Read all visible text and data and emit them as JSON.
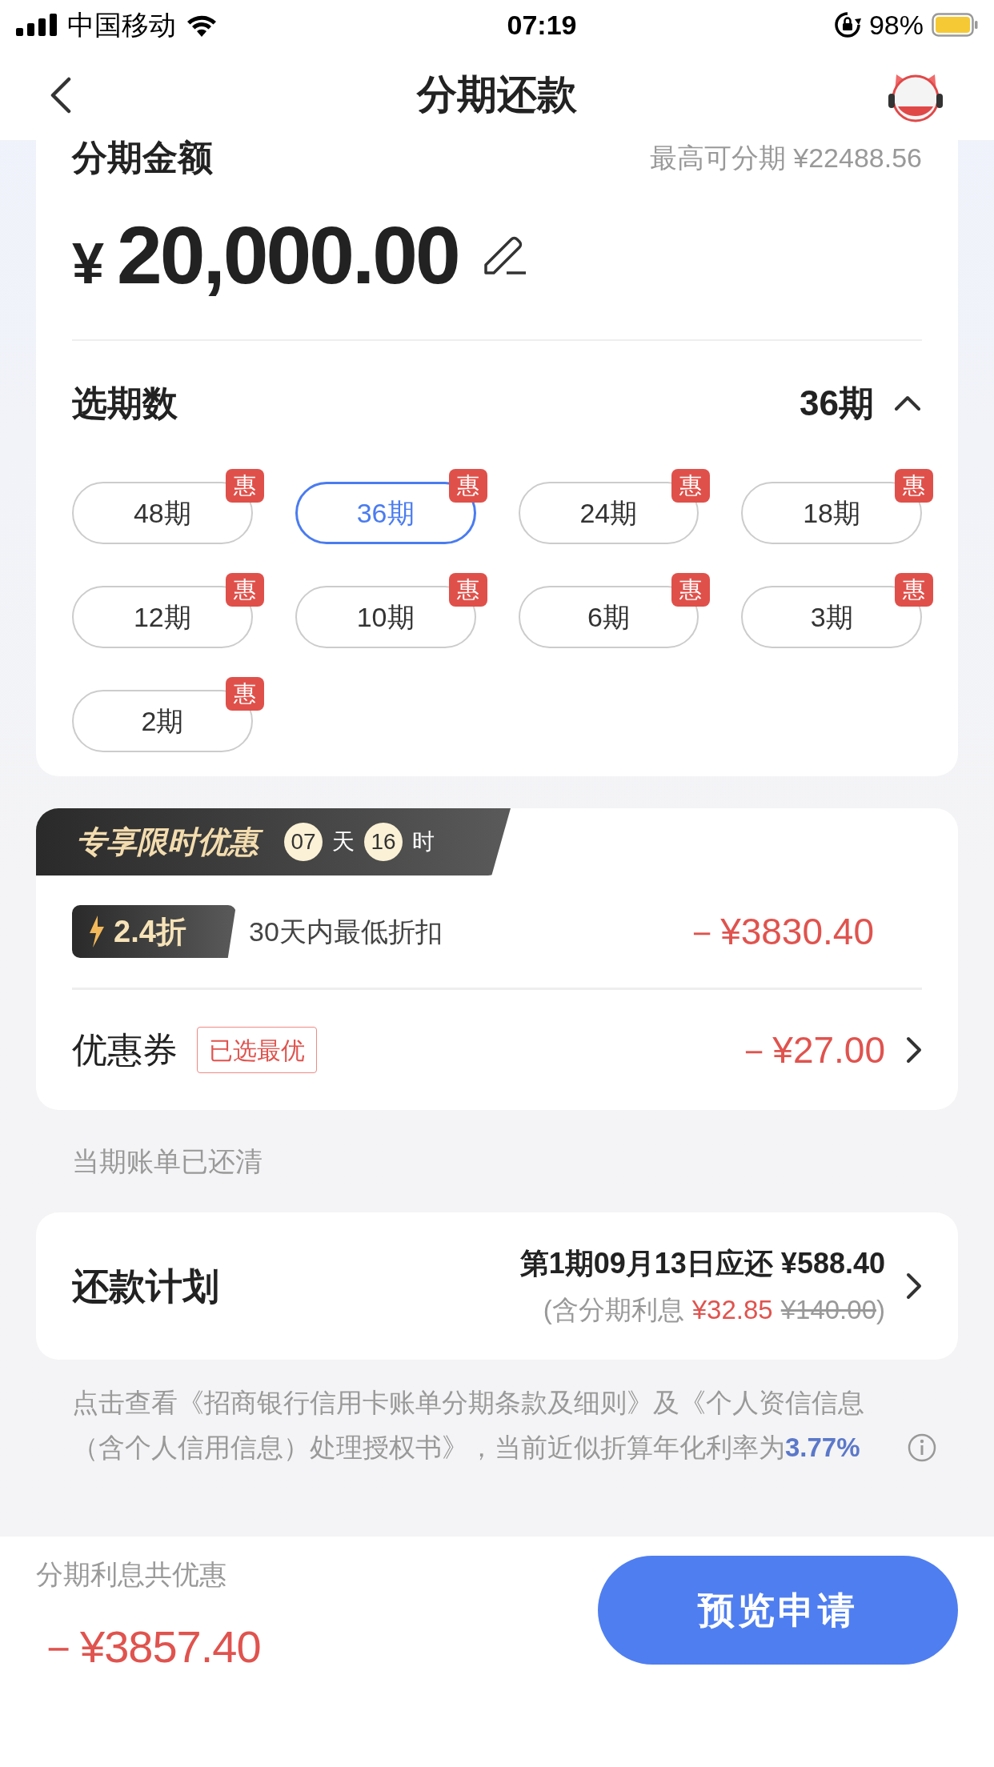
{
  "status_bar": {
    "carrier": "中国移动",
    "time": "07:19",
    "battery": "98%"
  },
  "nav": {
    "title": "分期还款"
  },
  "amount_card": {
    "label": "分期金额",
    "max": "最高可分期 ¥22488.56",
    "currency": "¥",
    "amount": "20,000.00"
  },
  "terms_selector": {
    "label": "选期数",
    "value": "36期",
    "expanded": true,
    "options": [
      {
        "label": "48期",
        "badge": "惠",
        "selected": false
      },
      {
        "label": "36期",
        "badge": "惠",
        "selected": true
      },
      {
        "label": "24期",
        "badge": "惠",
        "selected": false
      },
      {
        "label": "18期",
        "badge": "惠",
        "selected": false
      },
      {
        "label": "12期",
        "badge": "惠",
        "selected": false
      },
      {
        "label": "10期",
        "badge": "惠",
        "selected": false
      },
      {
        "label": "6期",
        "badge": "惠",
        "selected": false
      },
      {
        "label": "3期",
        "badge": "惠",
        "selected": false
      },
      {
        "label": "2期",
        "badge": "惠",
        "selected": false
      }
    ]
  },
  "promo": {
    "title": "专享限时优惠",
    "days": "07",
    "days_unit": "天",
    "hours": "16",
    "hours_unit": "时",
    "discount_badge": "2.4折",
    "discount_text": "30天内最低折扣",
    "discount_amount": "－¥3830.40",
    "coupon_label": "优惠券",
    "coupon_tag": "已选最优",
    "coupon_amount": "－¥27.00"
  },
  "bill_status": "当期账单已还清",
  "plan": {
    "label": "还款计划",
    "first_payment": "第1期09月13日应还 ¥588.40",
    "interest_prefix": "(含分期利息",
    "interest": "¥32.85",
    "original_interest": "¥140.00",
    "interest_suffix": ")"
  },
  "terms_text": "点击查看《招商银行信用卡账单分期条款及细则》及《个人资信信息（含个人信用信息）处理授权书》，当前近似折算年化利率为",
  "rate": "3.77%",
  "footer": {
    "label": "分期利息共优惠",
    "total": "－¥3857.40",
    "button": "预览申请"
  }
}
